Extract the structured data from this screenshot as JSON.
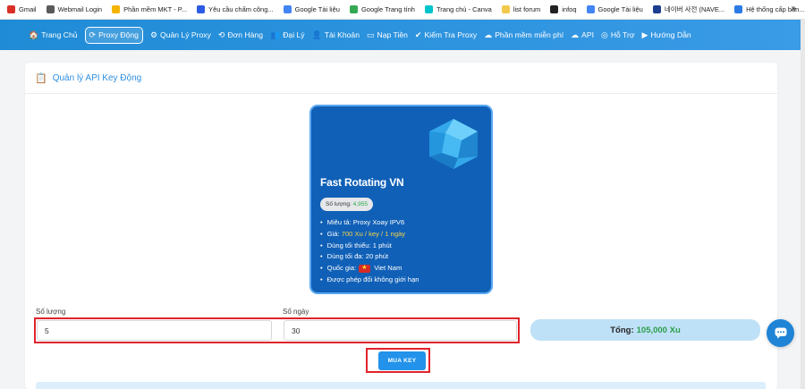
{
  "bookmarks": [
    {
      "label": "Gmail",
      "icon": "gmail-icon",
      "color": "#d93025"
    },
    {
      "label": "Webmail Login",
      "icon": "webmail-icon",
      "color": "#5a5a5a"
    },
    {
      "label": "Phần mềm MKT - P...",
      "icon": "drive-icon",
      "color": "#f4b400"
    },
    {
      "label": "Yêu cầu chấm công...",
      "icon": "form-icon",
      "color": "#2d5be3"
    },
    {
      "label": "Google Tài liệu",
      "icon": "docs-icon",
      "color": "#4285f4"
    },
    {
      "label": "Google Trang tính",
      "icon": "google-icon",
      "color": "#34a853"
    },
    {
      "label": "Trang chủ - Canva",
      "icon": "canva-icon",
      "color": "#00c4cc"
    },
    {
      "label": "list forum",
      "icon": "folder-icon",
      "color": "#f2c94c"
    },
    {
      "label": "infoq",
      "icon": "infoq-icon",
      "color": "#222222"
    },
    {
      "label": "Google Tài liệu",
      "icon": "docs-icon",
      "color": "#4285f4"
    },
    {
      "label": "네이버 사전 (NAVE...",
      "icon": "naver-icon",
      "color": "#1e3d8f"
    },
    {
      "label": "Hệ thống cấp bản...",
      "icon": "system-icon",
      "color": "#2c7be5"
    }
  ],
  "bookmarks_more": "»",
  "nav": [
    {
      "label": "Trang Chủ",
      "icon": "🏠"
    },
    {
      "label": "Proxy Động",
      "icon": "⟳",
      "active": true
    },
    {
      "label": "Quản Lý Proxy",
      "icon": "⚙"
    },
    {
      "label": "Đơn Hàng",
      "icon": "⟲"
    },
    {
      "label": "Đại Lý",
      "icon": "👥"
    },
    {
      "label": "Tài Khoản",
      "icon": "👤"
    },
    {
      "label": "Nạp Tiền",
      "icon": "▭"
    },
    {
      "label": "Kiểm Tra Proxy",
      "icon": "✔"
    },
    {
      "label": "Phần mềm miễn phí",
      "icon": "☁"
    },
    {
      "label": "API",
      "icon": "☁"
    },
    {
      "label": "Hỗ Trợ",
      "icon": "◎"
    },
    {
      "label": "Hướng Dẫn",
      "icon": "▶"
    }
  ],
  "card": {
    "title": "Quản lý API Key Động"
  },
  "product": {
    "name": "Fast Rotating VN",
    "quantity_label": "Số lượng:",
    "quantity_value": "4,955",
    "desc": "Miêu tả: Proxy Xoay IPV6",
    "price_label": "Giá:",
    "price_value": "700 Xu / key / 1 ngày",
    "min_use": "Dùng tối thiểu: 1 phút",
    "max_use": "Dùng tối đa: 20 phút",
    "country_label": "Quốc gia:",
    "country_value": "Viet Nam",
    "unlimited": "Được phép đổi không giới hạn"
  },
  "form": {
    "quantity_label": "Số lượng",
    "quantity_value": "5",
    "days_label": "Số ngày",
    "days_value": "30",
    "total_label": "Tổng:",
    "total_value": "105,000 Xu",
    "buy_label": "MUA KEY"
  },
  "colors": {
    "nav": "#2a92df",
    "product_bg": "#1060b7",
    "highlight": "#e0232b",
    "price": "#f3d44a",
    "total_value": "#2d9d4a"
  }
}
